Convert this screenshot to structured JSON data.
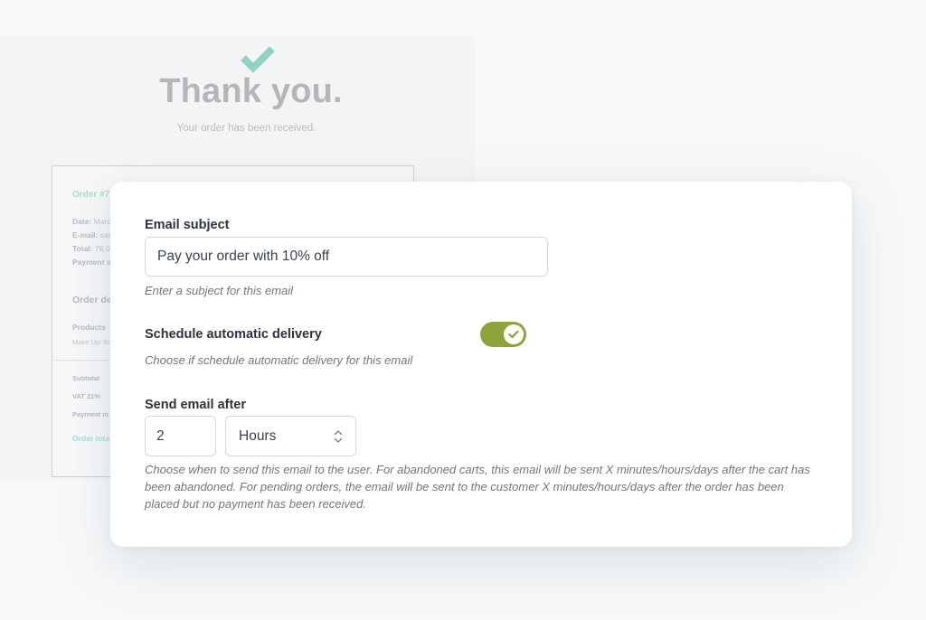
{
  "background_page": {
    "title": "Thank you.",
    "subtitle": "Your order has been received.",
    "order": {
      "order_label": "Order #7",
      "date_label": "Date:",
      "date_value": "Marc",
      "email_label": "E-mail:",
      "email_value": "sar",
      "total_label": "Total:",
      "total_value": "78,0",
      "payment_label": "Payment m",
      "details_heading": "Order de",
      "products_label": "Products",
      "product_name": "Make Up! Bo",
      "subtotal_label": "Subtotal",
      "vat_label": "VAT 21%",
      "payment_method_label": "Payment m",
      "order_total_label": "Order tota"
    }
  },
  "form": {
    "email_subject": {
      "label": "Email subject",
      "value": "Pay your order with 10% off",
      "help": "Enter a subject for this email"
    },
    "schedule": {
      "label": "Schedule automatic delivery",
      "enabled": true,
      "help": "Choose if schedule automatic delivery for this email"
    },
    "send_after": {
      "label": "Send email after",
      "amount": "2",
      "unit": "Hours",
      "help": "Choose when to send this email to the user. For abandoned carts, this email will be sent X minutes/hours/days after the cart has been abandoned. For pending orders, the email will be sent to the customer X minutes/hours/days after the order has been placed but no payment has been received."
    }
  },
  "colors": {
    "toggle_on": "#8ea43a",
    "checkmark": "#8fd3c4",
    "order_accent": "#a7dcd0"
  }
}
